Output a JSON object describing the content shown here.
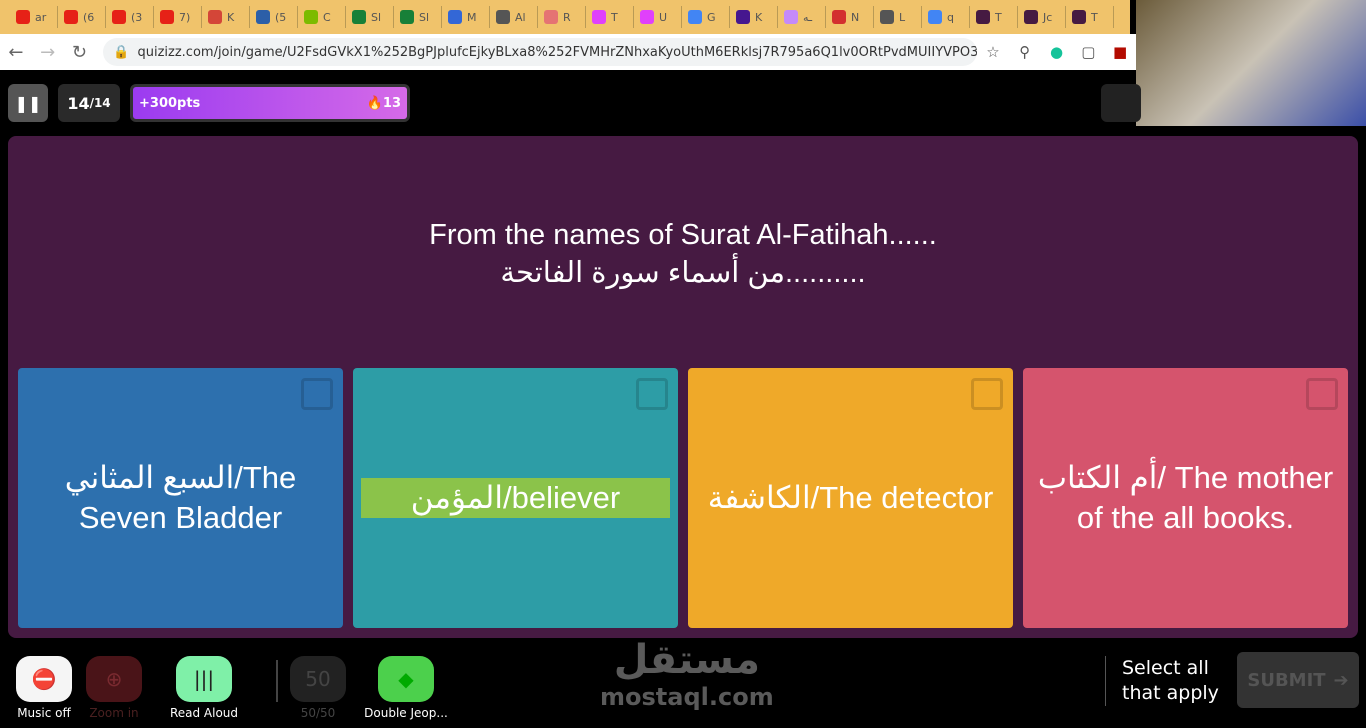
{
  "browser": {
    "tabs": [
      {
        "label": "ar",
        "color": "#e62117"
      },
      {
        "label": "(6",
        "color": "#e62117"
      },
      {
        "label": "(3",
        "color": "#e62117"
      },
      {
        "label": "7)",
        "color": "#e62117"
      },
      {
        "label": "K",
        "color": "#d44638"
      },
      {
        "label": "(5",
        "color": "#2c5fa8"
      },
      {
        "label": "C",
        "color": "#7cbb00"
      },
      {
        "label": "Sl",
        "color": "#188038"
      },
      {
        "label": "Sl",
        "color": "#188038"
      },
      {
        "label": "M",
        "color": "#3367d6"
      },
      {
        "label": "Al",
        "color": "#555"
      },
      {
        "label": "R",
        "color": "#e57373"
      },
      {
        "label": "T",
        "color": "#e040fb"
      },
      {
        "label": "U",
        "color": "#e040fb"
      },
      {
        "label": "G",
        "color": "#4285f4"
      },
      {
        "label": "K",
        "color": "#46178f"
      },
      {
        "label": "ـه",
        "color": "#c58af9"
      },
      {
        "label": "N",
        "color": "#d32f2f"
      },
      {
        "label": "L",
        "color": "#555"
      },
      {
        "label": "q",
        "color": "#4285f4"
      },
      {
        "label": "T",
        "color": "#461a42"
      },
      {
        "label": "Jc",
        "color": "#461a42"
      },
      {
        "label": "T",
        "color": "#461a42"
      }
    ],
    "url": "quizizz.com/join/game/U2FsdGVkX1%252BgPJplufcEjkyBLxa8%252FVMHrZNhxaKyoUthM6ERklsj7R795a6Q1lv0ORtPvdMUIIYVPO3..."
  },
  "game": {
    "question_current": "14",
    "question_total": "/14",
    "points": "+300pts",
    "streak": "13",
    "question_en": "From the names of Surat Al-Fatihah......",
    "question_ar": "من أسماء سورة الفاتحة..........",
    "options": [
      {
        "label": "السبع المثاني/The Seven Bladder",
        "color": "#2d70ae"
      },
      {
        "label": "المؤمن/believer",
        "color": "#2d9da6",
        "highlight": "#8bc34a"
      },
      {
        "label": "الكاشفة/The detector",
        "color": "#efa929"
      },
      {
        "label": "أم الكتاب/ The mother of the all books.",
        "color": "#d5546d"
      }
    ]
  },
  "powerups": [
    {
      "label": "Music off",
      "icon": "music-off-icon"
    },
    {
      "label": "Zoom in",
      "icon": "zoom-in-icon"
    },
    {
      "label": "Read Aloud",
      "icon": "read-aloud-icon"
    },
    {
      "label": "50/50",
      "icon": "fifty-fifty-icon"
    },
    {
      "label": "Double Jeop...",
      "icon": "double-jeopardy-icon"
    }
  ],
  "watermark": {
    "ar": "مستقل",
    "en": "mostaql.com"
  },
  "footer": {
    "instruction": "Select all that apply",
    "submit": "SUBMIT"
  }
}
